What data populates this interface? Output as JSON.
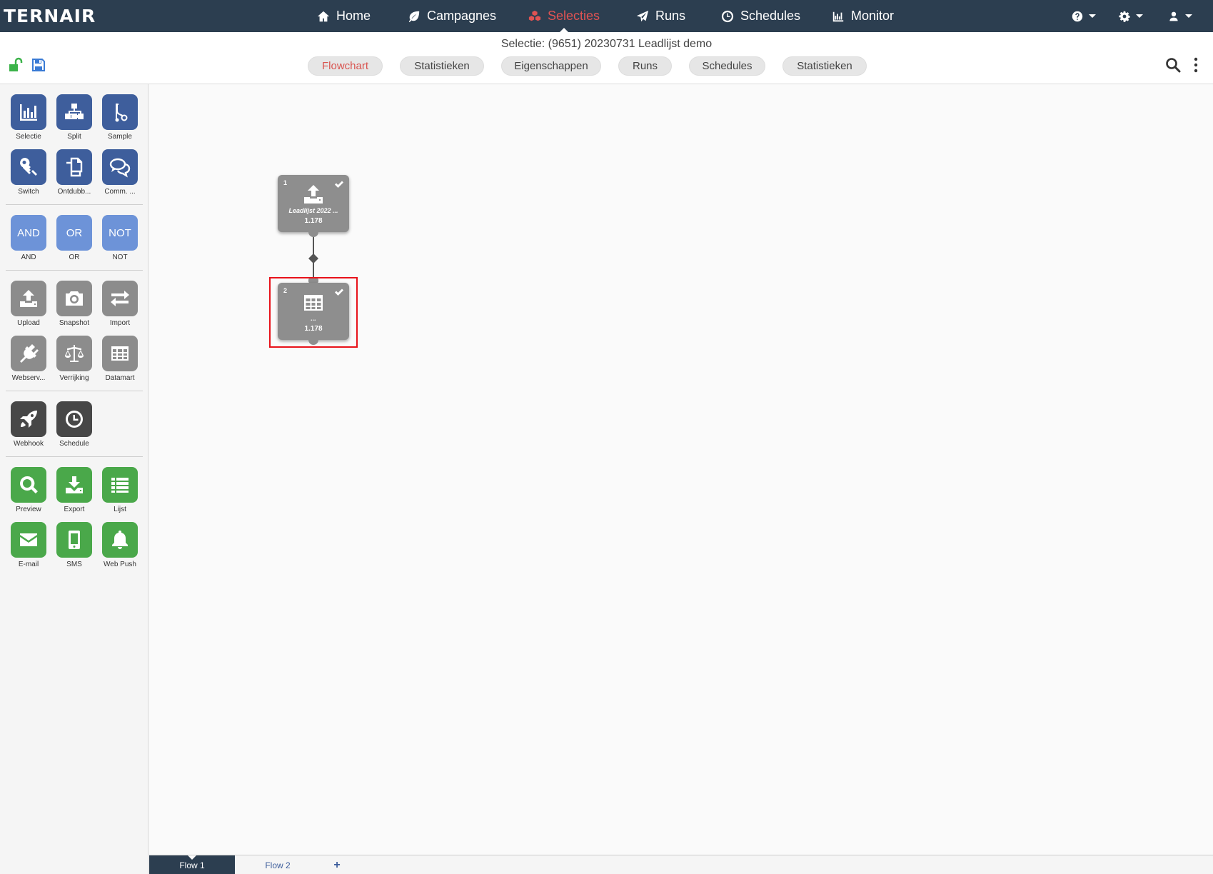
{
  "topbar": {
    "logo": "TERNAIR",
    "nav": [
      {
        "label": "Home",
        "icon": "home-icon"
      },
      {
        "label": "Campagnes",
        "icon": "leaf-icon"
      },
      {
        "label": "Selecties",
        "icon": "cubes-icon",
        "active": true
      },
      {
        "label": "Runs",
        "icon": "paper-plane-icon"
      },
      {
        "label": "Schedules",
        "icon": "clock-icon"
      },
      {
        "label": "Monitor",
        "icon": "bar-chart-icon"
      }
    ],
    "right_icons": [
      "help-icon",
      "gear-icon",
      "user-icon"
    ]
  },
  "header": {
    "title": "Selectie: (9651) 20230731 Leadlijst demo",
    "tabs": [
      {
        "label": "Flowchart",
        "active": true
      },
      {
        "label": "Statistieken"
      },
      {
        "label": "Eigenschappen"
      },
      {
        "label": "Runs"
      },
      {
        "label": "Schedules"
      },
      {
        "label": "Statistieken"
      }
    ]
  },
  "toolbox": {
    "groups": [
      [
        {
          "label": "Selectie",
          "icon": "bar-chart-icon",
          "color": "#3e5e9c"
        },
        {
          "label": "Split",
          "icon": "sitemap-icon",
          "color": "#3e5e9c"
        },
        {
          "label": "Sample",
          "icon": "branch-icon",
          "color": "#3e5e9c"
        },
        {
          "label": "Switch",
          "icon": "key-icon",
          "color": "#3e5e9c"
        },
        {
          "label": "Ontdubb...",
          "icon": "copy-icon",
          "color": "#3e5e9c"
        },
        {
          "label": "Comm. ...",
          "icon": "comments-icon",
          "color": "#3e5e9c"
        }
      ],
      [
        {
          "label": "AND",
          "text": "AND",
          "color": "#6d93d8"
        },
        {
          "label": "OR",
          "text": "OR",
          "color": "#6d93d8"
        },
        {
          "label": "NOT",
          "text": "NOT",
          "color": "#6d93d8"
        }
      ],
      [
        {
          "label": "Upload",
          "icon": "upload-icon",
          "color": "#8c8c8c"
        },
        {
          "label": "Snapshot",
          "icon": "camera-icon",
          "color": "#8c8c8c"
        },
        {
          "label": "Import",
          "icon": "exchange-icon",
          "color": "#8c8c8c"
        },
        {
          "label": "Webserv...",
          "icon": "plug-icon",
          "color": "#8c8c8c"
        },
        {
          "label": "Verrijking",
          "icon": "balance-scale-icon",
          "color": "#8c8c8c"
        },
        {
          "label": "Datamart",
          "icon": "table-icon",
          "color": "#8c8c8c"
        }
      ],
      [
        {
          "label": "Webhook",
          "icon": "rocket-icon",
          "color": "#474747"
        },
        {
          "label": "Schedule",
          "icon": "clock-icon",
          "color": "#474747"
        }
      ],
      [
        {
          "label": "Preview",
          "icon": "search-icon",
          "color": "#4aa84a"
        },
        {
          "label": "Export",
          "icon": "download-icon",
          "color": "#4aa84a"
        },
        {
          "label": "Lijst",
          "icon": "list-icon",
          "color": "#4aa84a"
        },
        {
          "label": "E-mail",
          "icon": "envelope-icon",
          "color": "#4aa84a"
        },
        {
          "label": "SMS",
          "icon": "mobile-icon",
          "color": "#4aa84a"
        },
        {
          "label": "Web Push",
          "icon": "bell-icon",
          "color": "#4aa84a"
        }
      ]
    ]
  },
  "flow": {
    "nodes": [
      {
        "number": "1",
        "name": "Leadlijst 2022 ...",
        "count": "1.178",
        "icon": "upload-icon",
        "status": "check-icon"
      },
      {
        "number": "2",
        "name": "...",
        "count": "1.178",
        "icon": "table-icon",
        "status": "check-icon",
        "selected": true
      }
    ]
  },
  "flowtabs": {
    "tabs": [
      {
        "label": "Flow 1",
        "active": true
      },
      {
        "label": "Flow 2"
      }
    ],
    "add": "+"
  },
  "colors": {
    "topbar": "#2c3e50",
    "accent": "#e05353",
    "highlight": "#e8121a"
  }
}
